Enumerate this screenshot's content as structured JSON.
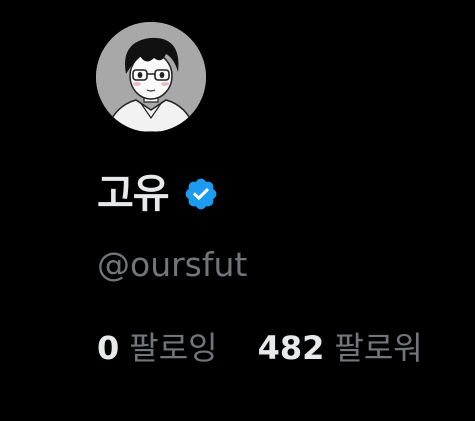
{
  "profile": {
    "display_name": "고유",
    "handle": "@oursfut",
    "verified": true,
    "verified_icon": "verified-badge-icon",
    "verified_color": "#1d9bf0"
  },
  "stats": {
    "following_count": "0",
    "following_label": "팔로잉",
    "followers_count": "482",
    "followers_label": "팔로워"
  },
  "colors": {
    "background": "#000000",
    "primary_text": "#e7e9ea",
    "secondary_text": "#71767b"
  }
}
